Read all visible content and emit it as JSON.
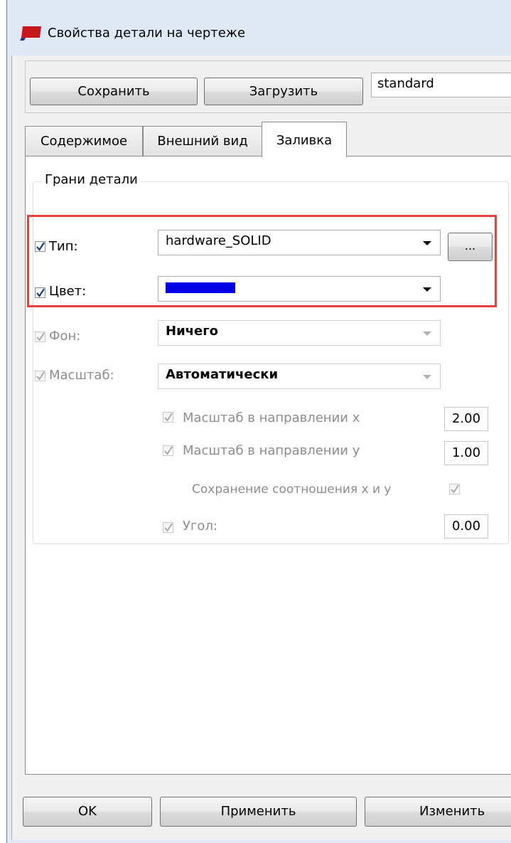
{
  "window": {
    "title": "Свойства детали на чертеже"
  },
  "toolbar": {
    "save_label": "Сохранить",
    "load_label": "Загрузить",
    "settings_name": "standard"
  },
  "tabs": [
    {
      "label": "Содержимое"
    },
    {
      "label": "Внешний вид"
    },
    {
      "label": "Заливка"
    }
  ],
  "group": {
    "title": "Грани детали"
  },
  "fields": {
    "type": {
      "label": "Тип:",
      "value": "hardware_SOLID",
      "checked": true,
      "browse_label": "..."
    },
    "color": {
      "label": "Цвет:",
      "swatch_color": "#0000e6",
      "checked": true
    },
    "background": {
      "label": "Фон:",
      "value": "Ничего",
      "checked": true,
      "disabled": true
    },
    "scale": {
      "label": "Масштаб:",
      "value": "Автоматически",
      "checked": true,
      "disabled": true
    },
    "scale_x": {
      "label": "Масштаб в направлении x",
      "value": "2.00"
    },
    "scale_y": {
      "label": "Масштаб в направлении y",
      "value": "1.00"
    },
    "keep_ratio": {
      "label": "Сохранение соотношения x и y"
    },
    "angle": {
      "label": "Угол:",
      "value": "0.00"
    }
  },
  "footer": {
    "ok_label": "OK",
    "apply_label": "Применить",
    "modify_label": "Изменить"
  },
  "colors": {
    "highlight": "#e8403d",
    "swatch": "#0000e6"
  }
}
